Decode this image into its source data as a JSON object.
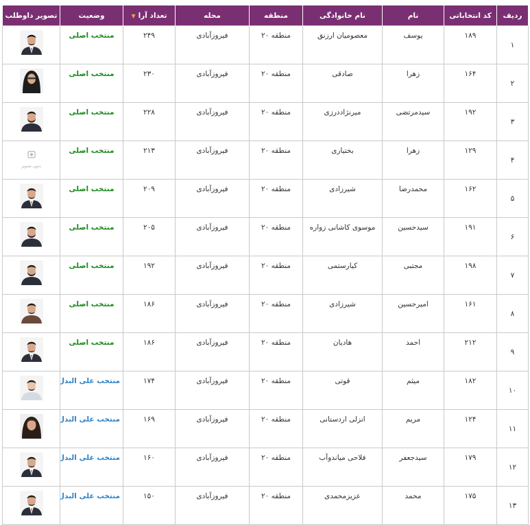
{
  "table": {
    "headers": {
      "rownum": "ردیف",
      "code": "کد انتخاباتی",
      "first_name": "نام",
      "last_name": "نام خانوادگی",
      "region": "منطقه",
      "area": "محله",
      "votes": "تعداد آرا",
      "status": "وضعیت",
      "photo": "تصویر داوطلب"
    },
    "sorted_column": "votes",
    "rows": [
      {
        "rownum": "۱",
        "code": "۱۸۹",
        "first_name": "یوسف",
        "last_name": "معصومیان ارزنق",
        "region": "منطقه ۲۰",
        "area": "فیروزآبادی",
        "votes": "۲۴۹",
        "status": "منتخب اصلی",
        "status_type": "main",
        "photo": "man-suit"
      },
      {
        "rownum": "۲",
        "code": "۱۶۴",
        "first_name": "زهرا",
        "last_name": "صادقی",
        "region": "منطقه ۲۰",
        "area": "فیروزآبادی",
        "votes": "۲۳۰",
        "status": "منتخب اصلی",
        "status_type": "main",
        "photo": "woman-chador"
      },
      {
        "rownum": "۳",
        "code": "۱۹۲",
        "first_name": "سیدمرتضی",
        "last_name": "میرنژاددرزی",
        "region": "منطقه ۲۰",
        "area": "فیروزآبادی",
        "votes": "۲۲۸",
        "status": "منتخب اصلی",
        "status_type": "main",
        "photo": "man-beard"
      },
      {
        "rownum": "۴",
        "code": "۱۲۹",
        "first_name": "زهرا",
        "last_name": "بختیاری",
        "region": "منطقه ۲۰",
        "area": "فیروزآبادی",
        "votes": "۲۱۳",
        "status": "منتخب اصلی",
        "status_type": "main",
        "photo": "placeholder",
        "photo_caption": "بدون تصویر"
      },
      {
        "rownum": "۵",
        "code": "۱۶۲",
        "first_name": "محمدرضا",
        "last_name": "شیرزادی",
        "region": "منطقه ۲۰",
        "area": "فیروزآبادی",
        "votes": "۲۰۹",
        "status": "منتخب اصلی",
        "status_type": "main",
        "photo": "man-suit"
      },
      {
        "rownum": "۶",
        "code": "۱۹۱",
        "first_name": "سیدحسین",
        "last_name": "موسوی کاشانی زواره",
        "region": "منطقه ۲۰",
        "area": "فیروزآبادی",
        "votes": "۲۰۵",
        "status": "منتخب اصلی",
        "status_type": "main",
        "photo": "man-beard"
      },
      {
        "rownum": "۷",
        "code": "۱۹۸",
        "first_name": "مجتبی",
        "last_name": "کیارستمی",
        "region": "منطقه ۲۰",
        "area": "فیروزآبادی",
        "votes": "۱۹۲",
        "status": "منتخب اصلی",
        "status_type": "main",
        "photo": "man-beard"
      },
      {
        "rownum": "۸",
        "code": "۱۶۱",
        "first_name": "امیرحسین",
        "last_name": "شیرزادی",
        "region": "منطقه ۲۰",
        "area": "فیروزآبادی",
        "votes": "۱۸۶",
        "status": "منتخب اصلی",
        "status_type": "main",
        "photo": "man-casual"
      },
      {
        "rownum": "۹",
        "code": "۲۱۲",
        "first_name": "احمد",
        "last_name": "هادیان",
        "region": "منطقه ۲۰",
        "area": "فیروزآبادی",
        "votes": "۱۸۶",
        "status": "منتخب اصلی",
        "status_type": "main",
        "photo": "man-suit"
      },
      {
        "rownum": "۱۰",
        "code": "۱۸۲",
        "first_name": "میثم",
        "last_name": "قوتی",
        "region": "منطقه ۲۰",
        "area": "فیروزآبادی",
        "votes": "۱۷۴",
        "status": "منتخب علی البدل",
        "status_type": "alt",
        "photo": "man-light"
      },
      {
        "rownum": "۱۱",
        "code": "۱۲۴",
        "first_name": "مریم",
        "last_name": "انزلی اردستانی",
        "region": "منطقه ۲۰",
        "area": "فیروزآبادی",
        "votes": "۱۶۹",
        "status": "منتخب علی البدل",
        "status_type": "alt",
        "photo": "woman-scarf"
      },
      {
        "rownum": "۱۲",
        "code": "۱۷۹",
        "first_name": "سیدجعفر",
        "last_name": "فلاحی میاندوآب",
        "region": "منطقه ۲۰",
        "area": "فیروزآبادی",
        "votes": "۱۶۰",
        "status": "منتخب علی البدل",
        "status_type": "alt",
        "photo": "man-suit"
      },
      {
        "rownum": "۱۳",
        "code": "۱۷۵",
        "first_name": "محمد",
        "last_name": "عزیزمحمدی",
        "region": "منطقه ۲۰",
        "area": "فیروزآبادی",
        "votes": "۱۵۰",
        "status": "منتخب علی البدل",
        "status_type": "alt",
        "photo": "man-suit"
      }
    ]
  },
  "colors": {
    "header_bg": "#7a2f73",
    "header_text": "#ffffff",
    "sort_arrow": "#e8a33a",
    "status_main": "#1b8a1b",
    "status_alt": "#2f83c8",
    "border": "#c9c9c9"
  }
}
